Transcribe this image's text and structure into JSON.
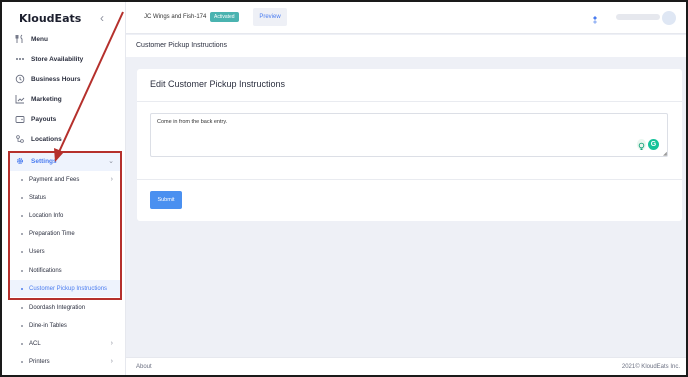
{
  "app": {
    "brand": "KloudEats"
  },
  "sidebar": {
    "items": [
      {
        "label": "Menu",
        "icon": "utensils-icon"
      },
      {
        "label": "Store Availability",
        "icon": "dots-icon"
      },
      {
        "label": "Business Hours",
        "icon": "clock-icon"
      },
      {
        "label": "Marketing",
        "icon": "chart-icon"
      },
      {
        "label": "Payouts",
        "icon": "wallet-icon"
      },
      {
        "label": "Locations",
        "icon": "map-icon"
      },
      {
        "label": "Settings",
        "icon": "gear-icon"
      }
    ],
    "settings_children": [
      "Payment and Fees",
      "Status",
      "Location Info",
      "Preparation Time",
      "Users",
      "Notifications",
      "Customer Pickup Instructions"
    ],
    "after_settings": [
      "Doordash Integration",
      "Dine-in Tables",
      "ACL",
      "Printers"
    ]
  },
  "topbar": {
    "store_name": "JC Wings and Fish-174",
    "status_badge": "Activated",
    "preview_label": "Preview"
  },
  "page": {
    "title": "Customer Pickup Instructions"
  },
  "card": {
    "title": "Edit Customer Pickup Instructions",
    "textarea_value": "Come in from the back entry.",
    "submit_label": "Submit"
  },
  "footer": {
    "about": "About",
    "copyright": "2021© KloudEats Inc."
  },
  "colors": {
    "accent": "#4a7cf0",
    "annotation": "#b5302c",
    "badge": "#4ab3b0",
    "submit": "#4a90f0"
  }
}
